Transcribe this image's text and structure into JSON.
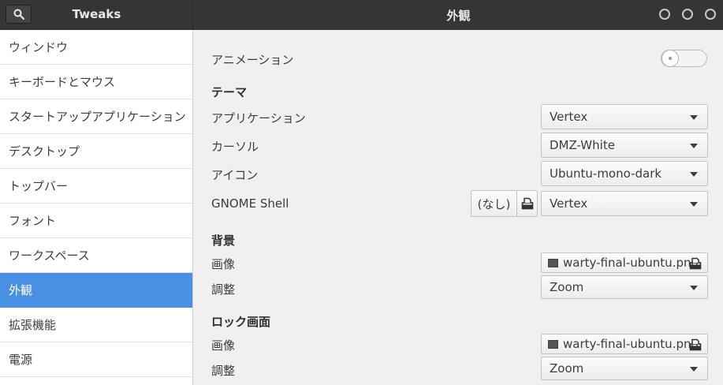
{
  "header": {
    "app_title": "Tweaks",
    "page_title": "外観"
  },
  "sidebar": {
    "items": [
      {
        "label": "ウィンドウ"
      },
      {
        "label": "キーボードとマウス"
      },
      {
        "label": "スタートアップアプリケーション"
      },
      {
        "label": "デスクトップ"
      },
      {
        "label": "トップバー"
      },
      {
        "label": "フォント"
      },
      {
        "label": "ワークスペース"
      },
      {
        "label": "外観",
        "active": true
      },
      {
        "label": "拡張機能"
      },
      {
        "label": "電源"
      }
    ]
  },
  "main": {
    "animation": {
      "label": "アニメーション",
      "enabled": false
    },
    "theme": {
      "heading": "テーマ",
      "applications": {
        "label": "アプリケーション",
        "value": "Vertex"
      },
      "cursor": {
        "label": "カーソル",
        "value": "DMZ-White"
      },
      "icons": {
        "label": "アイコン",
        "value": "Ubuntu-mono-dark"
      },
      "shell": {
        "label": "GNOME Shell",
        "none_label": "(なし)",
        "value": "Vertex"
      }
    },
    "background": {
      "heading": "背景",
      "image": {
        "label": "画像",
        "value": "warty-final-ubuntu.png"
      },
      "adjustment": {
        "label": "調整",
        "value": "Zoom"
      }
    },
    "lock_screen": {
      "heading": "ロック画面",
      "image": {
        "label": "画像",
        "value": "warty-final-ubuntu.png"
      },
      "adjustment": {
        "label": "調整",
        "value": "Zoom"
      }
    }
  },
  "colors": {
    "header_bg": "#353535",
    "accent": "#4a90e2",
    "sidebar_bg": "#ffffff",
    "content_bg": "#f0f0f0"
  },
  "icons": {
    "search": "search-icon",
    "window_buttons": [
      "minimize-icon",
      "maximize-icon",
      "close-icon"
    ],
    "file_open": "document-open-icon",
    "image_file": "image-file-icon"
  }
}
